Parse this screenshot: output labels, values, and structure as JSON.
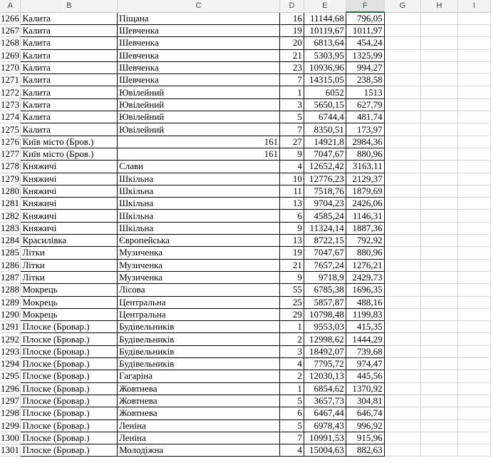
{
  "columns": [
    "A",
    "B",
    "C",
    "D",
    "E",
    "F",
    "G",
    "H",
    "I"
  ],
  "selected_column": "F",
  "rows": [
    [
      "1266",
      "Калита",
      "Піщана",
      "",
      "16",
      "11144,68",
      "796,05"
    ],
    [
      "1267",
      "Калита",
      "Шевченка",
      "",
      "19",
      "10119,67",
      "1011,97"
    ],
    [
      "1268",
      "Калита",
      "Шевченка",
      "",
      "20",
      "6813,64",
      "454,24"
    ],
    [
      "1269",
      "Калита",
      "Шевченка",
      "",
      "21",
      "5303,95",
      "1325,99"
    ],
    [
      "1270",
      "Калита",
      "Шевченка",
      "",
      "23",
      "10936,96",
      "994,27"
    ],
    [
      "1271",
      "Калита",
      "Шевченка",
      "",
      "7",
      "14315,05",
      "238,58"
    ],
    [
      "1272",
      "Калита",
      "Ювілейний",
      "",
      "1",
      "6052",
      "1513"
    ],
    [
      "1273",
      "Калита",
      "Ювілейний",
      "",
      "3",
      "5650,15",
      "627,79"
    ],
    [
      "1274",
      "Калита",
      "Ювілейний",
      "",
      "5",
      "6744,4",
      "481,74"
    ],
    [
      "1275",
      "Калита",
      "Ювілейний",
      "",
      "7",
      "8350,51",
      "173,97"
    ],
    [
      "1276",
      "Київ місто (Бров.)",
      "",
      "161",
      "27",
      "14921,8",
      "2984,36"
    ],
    [
      "1277",
      "Київ місто (Бров.)",
      "",
      "161",
      "9",
      "7047,67",
      "880,96"
    ],
    [
      "1278",
      "Княжичі",
      "Слави",
      "",
      "4",
      "12652,42",
      "3163,11"
    ],
    [
      "1279",
      "Княжичі",
      "Шкільна",
      "",
      "10",
      "12776,23",
      "2129,37"
    ],
    [
      "1280",
      "Княжичі",
      "Шкільна",
      "",
      "11",
      "7518,76",
      "1879,69"
    ],
    [
      "1281",
      "Княжичі",
      "Шкільна",
      "",
      "13",
      "9704,23",
      "2426,06"
    ],
    [
      "1282",
      "Княжичі",
      "Шкільна",
      "",
      "6",
      "4585,24",
      "1146,31"
    ],
    [
      "1283",
      "Княжичі",
      "Шкільна",
      "",
      "9",
      "11324,14",
      "1887,36"
    ],
    [
      "1284",
      "Красилівка",
      "Європейська",
      "",
      "13",
      "8722,15",
      "792,92"
    ],
    [
      "1285",
      "Літки",
      "Музиченка",
      "",
      "19",
      "7047,67",
      "880,96"
    ],
    [
      "1286",
      "Літки",
      "Музиченка",
      "",
      "21",
      "7657,24",
      "1276,21"
    ],
    [
      "1287",
      "Літки",
      "Музиченка",
      "",
      "9",
      "9718,9",
      "2429,73"
    ],
    [
      "1288",
      "Мокрець",
      "Лісова",
      "",
      "55",
      "6785,38",
      "1696,35"
    ],
    [
      "1289",
      "Мокрець",
      "Центральна",
      "",
      "25",
      "5857,87",
      "488,16"
    ],
    [
      "1290",
      "Мокрець",
      "Центральна",
      "",
      "29",
      "10798,48",
      "1199,83"
    ],
    [
      "1291",
      "Плоске (Бровар.)",
      "Будівельників",
      "",
      "1",
      "9553,03",
      "415,35"
    ],
    [
      "1292",
      "Плоске (Бровар.)",
      "Будівельників",
      "",
      "2",
      "12998,62",
      "1444,29"
    ],
    [
      "1293",
      "Плоске (Бровар.)",
      "Будівельників",
      "",
      "3",
      "18492,07",
      "739,68"
    ],
    [
      "1294",
      "Плоске (Бровар.)",
      "Будівельників",
      "",
      "4",
      "7795,72",
      "974,47"
    ],
    [
      "1295",
      "Плоске (Бровар.)",
      "Гагаріна",
      "",
      "2",
      "12030,13",
      "445,56"
    ],
    [
      "1296",
      "Плоске (Бровар.)",
      "Жовтнева",
      "",
      "1",
      "6854,62",
      "1370,92"
    ],
    [
      "1297",
      "Плоске (Бровар.)",
      "Жовтнева",
      "",
      "5",
      "3657,73",
      "304,81"
    ],
    [
      "1298",
      "Плоске (Бровар.)",
      "Жовтнева",
      "",
      "6",
      "6467,44",
      "646,74"
    ],
    [
      "1299",
      "Плоске (Бровар.)",
      "Леніна",
      "",
      "5",
      "6978,43",
      "996,92"
    ],
    [
      "1300",
      "Плоске (Бровар.)",
      "Леніна",
      "",
      "7",
      "10991,53",
      "915,96"
    ],
    [
      "1301",
      "Плоске (Бровар.)",
      "Молодіжна",
      "",
      "4",
      "15004,63",
      "882,63"
    ]
  ]
}
